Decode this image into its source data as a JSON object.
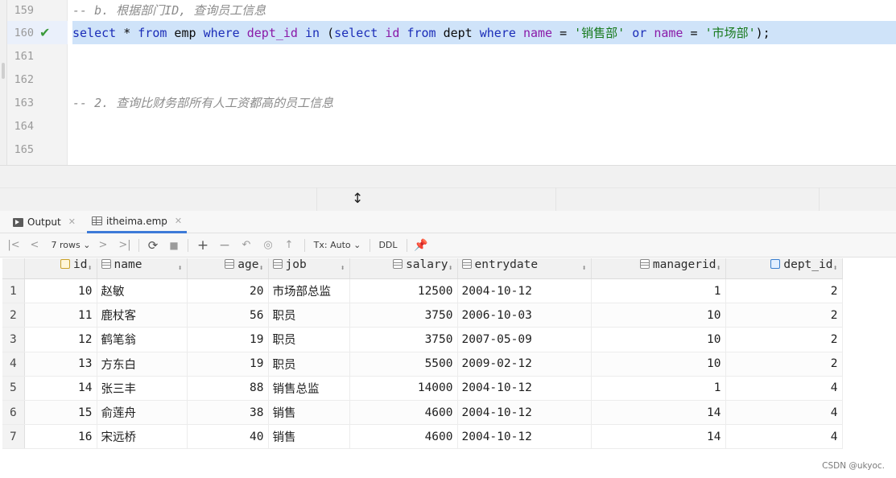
{
  "editor": {
    "lines": [
      {
        "number": "159",
        "comment": "-- b. 根据部门ID, 查询员工信息"
      },
      {
        "number": "160"
      },
      {
        "number": "161"
      },
      {
        "number": "162"
      },
      {
        "number": "163",
        "comment": "-- 2. 查询比财务部所有人工资都高的员工信息"
      },
      {
        "number": "164"
      },
      {
        "number": "165"
      }
    ],
    "sql": {
      "t1": "select",
      "t2": " * ",
      "t3": "from",
      "t4": " emp ",
      "t5": "where",
      "t6": " ",
      "t7": "dept_id",
      "t8": " ",
      "t9": "in",
      "t10": " (",
      "t11": "select",
      "t12": " ",
      "t13": "id",
      "t14": " ",
      "t15": "from",
      "t16": " dept ",
      "t17": "where",
      "t18": " ",
      "t19": "name",
      "t20": " = ",
      "t21": "'销售部'",
      "t22": " ",
      "t23": "or",
      "t24": " ",
      "t25": "name",
      "t26": " = ",
      "t27": "'市场部'",
      "t28": ");"
    },
    "status_icon": "check-icon"
  },
  "tabs": [
    {
      "label": "Output",
      "icon": "output-icon"
    },
    {
      "label": "itheima.emp",
      "icon": "table-icon"
    }
  ],
  "toolbar": {
    "rows_label": "7 rows",
    "tx_label": "Tx: Auto",
    "ddl_label": "DDL"
  },
  "grid": {
    "columns": [
      "id",
      "name",
      "age",
      "job",
      "salary",
      "entrydate",
      "managerid",
      "dept_id"
    ],
    "rows": [
      {
        "n": "1",
        "id": "10",
        "name": "赵敏",
        "age": "20",
        "job": "市场部总监",
        "salary": "12500",
        "entrydate": "2004-10-12",
        "managerid": "1",
        "dept_id": "2"
      },
      {
        "n": "2",
        "id": "11",
        "name": "鹿杖客",
        "age": "56",
        "job": "职员",
        "salary": "3750",
        "entrydate": "2006-10-03",
        "managerid": "10",
        "dept_id": "2"
      },
      {
        "n": "3",
        "id": "12",
        "name": "鹤笔翁",
        "age": "19",
        "job": "职员",
        "salary": "3750",
        "entrydate": "2007-05-09",
        "managerid": "10",
        "dept_id": "2"
      },
      {
        "n": "4",
        "id": "13",
        "name": "方东白",
        "age": "19",
        "job": "职员",
        "salary": "5500",
        "entrydate": "2009-02-12",
        "managerid": "10",
        "dept_id": "2"
      },
      {
        "n": "5",
        "id": "14",
        "name": "张三丰",
        "age": "88",
        "job": "销售总监",
        "salary": "14000",
        "entrydate": "2004-10-12",
        "managerid": "1",
        "dept_id": "4"
      },
      {
        "n": "6",
        "id": "15",
        "name": "俞莲舟",
        "age": "38",
        "job": "销售",
        "salary": "4600",
        "entrydate": "2004-10-12",
        "managerid": "14",
        "dept_id": "4"
      },
      {
        "n": "7",
        "id": "16",
        "name": "宋远桥",
        "age": "40",
        "job": "销售",
        "salary": "4600",
        "entrydate": "2004-10-12",
        "managerid": "14",
        "dept_id": "4"
      }
    ]
  },
  "watermark": "CSDN @ukyoc."
}
